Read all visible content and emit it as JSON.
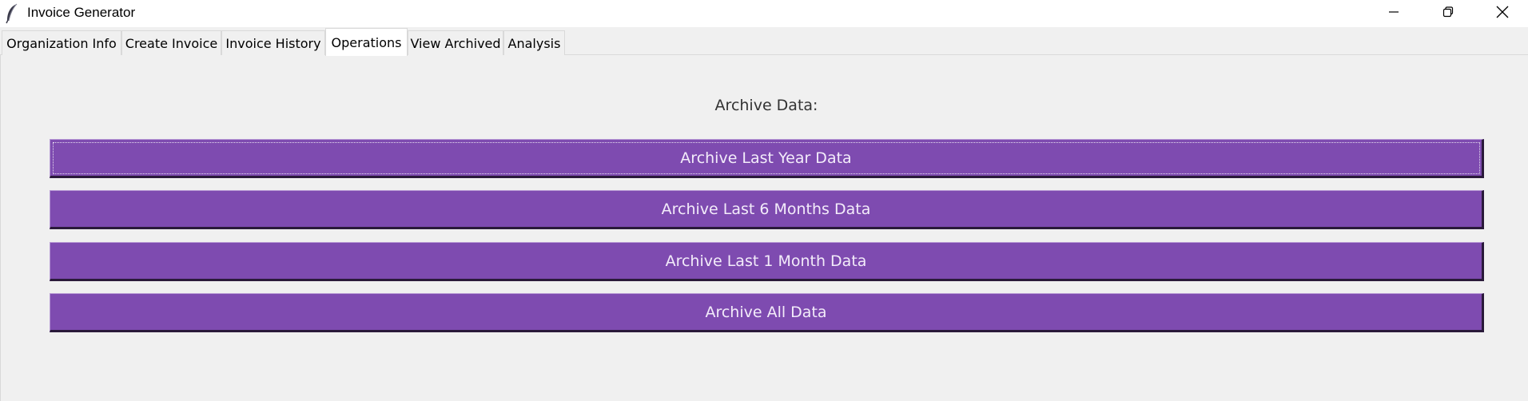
{
  "window": {
    "title": "Invoice Generator",
    "app_icon": "feather-icon",
    "controls": [
      "minimize-icon",
      "restore-icon",
      "close-icon"
    ]
  },
  "tabs": [
    {
      "label": "Organization Info",
      "active": false
    },
    {
      "label": "Create Invoice",
      "active": false
    },
    {
      "label": "Invoice History",
      "active": false
    },
    {
      "label": "Operations",
      "active": true
    },
    {
      "label": "View Archived",
      "active": false
    },
    {
      "label": "Analysis",
      "active": false
    }
  ],
  "operations": {
    "section_title": "Archive Data:",
    "buttons": [
      {
        "label": "Archive Last Year Data",
        "focused": true
      },
      {
        "label": "Archive Last 6 Months Data",
        "focused": false
      },
      {
        "label": "Archive Last 1 Month Data",
        "focused": false
      },
      {
        "label": "Archive All Data",
        "focused": false
      }
    ]
  },
  "colors": {
    "button_bg": "#7e4bb0",
    "button_text": "#f3ecfa",
    "window_bg": "#f0f0f0",
    "title_text": "#333333"
  }
}
